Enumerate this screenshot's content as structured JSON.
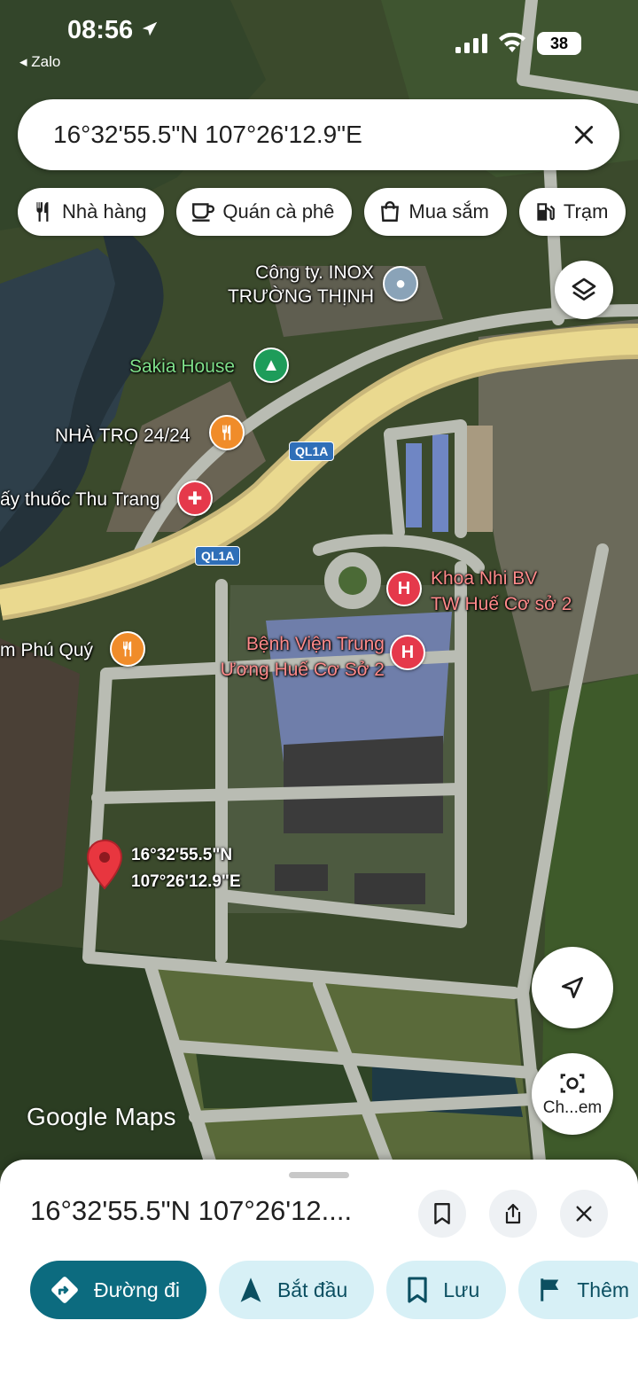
{
  "status_bar": {
    "time": "08:56",
    "back_app": "◂ Zalo",
    "battery": "38"
  },
  "search": {
    "value": "16°32'55.5\"N 107°26'12.9\"E"
  },
  "chips": [
    {
      "label": "Nhà hàng",
      "icon": "restaurant-icon"
    },
    {
      "label": "Quán cà phê",
      "icon": "coffee-icon"
    },
    {
      "label": "Mua sắm",
      "icon": "shopping-bag-icon"
    },
    {
      "label": "Trạm",
      "icon": "gas-station-icon"
    }
  ],
  "map": {
    "pois": [
      {
        "name": "Công ty. INOX\nTRƯỜNG THỊNH",
        "type": "place"
      },
      {
        "name": "Sakia House",
        "type": "park"
      },
      {
        "name": "NHÀ TRỌ 24/24",
        "type": "restaurant"
      },
      {
        "name": "ấy thuốc Thu Trang",
        "type": "pharmacy"
      },
      {
        "name": "m Phú Quý",
        "type": "restaurant"
      },
      {
        "name": "Khoa Nhi BV\nTW Huế Cơ sở 2",
        "type": "hospital"
      },
      {
        "name": "Bệnh Viện Trung\nƯơng Huế Cơ Sở 2",
        "type": "hospital"
      }
    ],
    "road_shields": [
      "QL1A",
      "QL1A"
    ],
    "dropped_pin": {
      "lat": "16°32'55.5\"N",
      "lng": "107°26'12.9\"E"
    },
    "attribution": "Google Maps",
    "camera_button_label": "Ch...em"
  },
  "sheet": {
    "title": "16°32'55.5\"N 107°26'12....",
    "actions": [
      {
        "label": "Đường đi",
        "icon": "directions-icon",
        "primary": true
      },
      {
        "label": "Bắt đầu",
        "icon": "navigation-arrow-icon",
        "primary": false
      },
      {
        "label": "Lưu",
        "icon": "bookmark-icon",
        "primary": false
      },
      {
        "label": "Thêm",
        "icon": "flag-icon",
        "primary": false
      }
    ]
  },
  "colors": {
    "accent": "#0c6b7f",
    "chip_bg": "#d7f0f6",
    "hospital": "#e5394b",
    "restaurant": "#f08c2a",
    "road": "#e6d38a"
  }
}
